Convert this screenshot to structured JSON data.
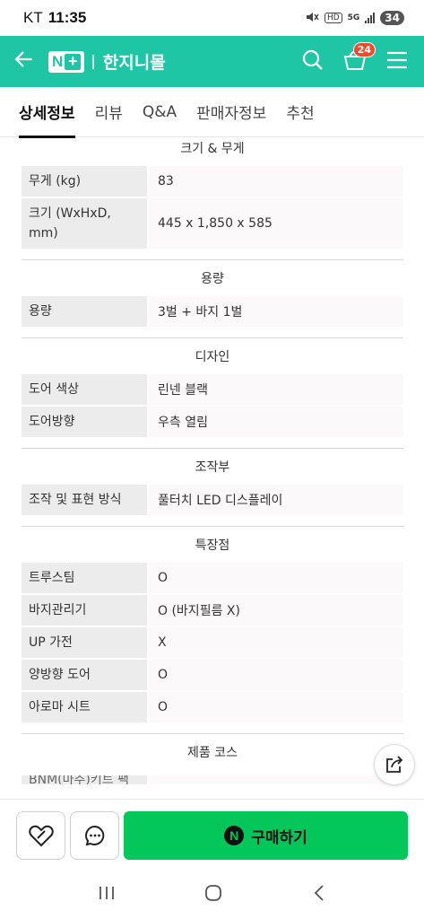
{
  "status": {
    "carrier": "KT",
    "time": "11:35",
    "network": "5G",
    "hd": "HD",
    "battery": "34"
  },
  "header": {
    "logo_text": "N",
    "logo_plus": "+",
    "store_name": "한지니몰",
    "cart_count": "24"
  },
  "tabs": [
    {
      "label": "상세정보"
    },
    {
      "label": "리뷰"
    },
    {
      "label": "Q&A"
    },
    {
      "label": "판매자정보"
    },
    {
      "label": "추천"
    }
  ],
  "sections": [
    {
      "title": "크기 & 무게",
      "rows": [
        {
          "key": "무게 (kg)",
          "value": "83"
        },
        {
          "key": "크기 (WxHxD, mm)",
          "value": "445 x 1,850 x 585"
        }
      ]
    },
    {
      "title": "용량",
      "rows": [
        {
          "key": "용량",
          "value": "3벌 + 바지 1벌"
        }
      ]
    },
    {
      "title": "디자인",
      "rows": [
        {
          "key": "도어 색상",
          "value": "린넨 블랙"
        },
        {
          "key": "도어방향",
          "value": "우측 열림"
        }
      ]
    },
    {
      "title": "조작부",
      "rows": [
        {
          "key": "조작 및 표현 방식",
          "value": "풀터치 LED 디스플레이"
        }
      ]
    },
    {
      "title": "특장점",
      "rows": [
        {
          "key": "트루스팀",
          "value": "O"
        },
        {
          "key": "바지관리기",
          "value": "O (바지필름 X)"
        },
        {
          "key": "UP 가전",
          "value": "X"
        },
        {
          "key": "양방향 도어",
          "value": "O"
        },
        {
          "key": "아로마 시트",
          "value": "O"
        }
      ]
    },
    {
      "title": "제품 코스",
      "rows": [
        {
          "key": "BNM(마추)키트 팩",
          "value": ""
        }
      ]
    }
  ],
  "buybar": {
    "buy_label": "구매하기",
    "buy_icon_letter": "N"
  },
  "colors": {
    "brand": "#1ec6a5",
    "buy": "#03c75a",
    "badge": "#f04a2a"
  }
}
